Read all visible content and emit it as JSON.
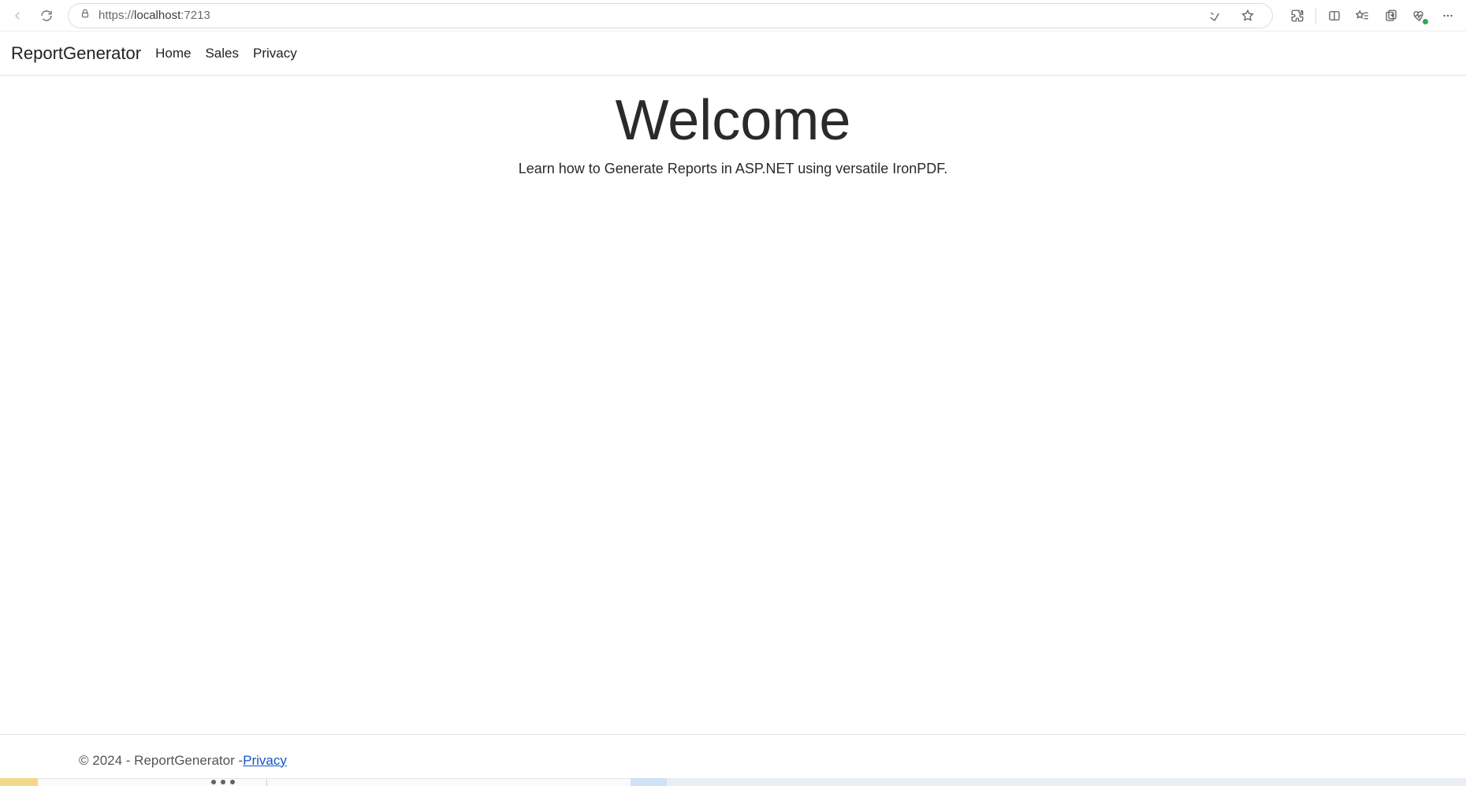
{
  "browser": {
    "url_scheme": "https://",
    "url_host": "localhost",
    "url_port": ":7213"
  },
  "nav": {
    "brand": "ReportGenerator",
    "links": [
      "Home",
      "Sales",
      "Privacy"
    ]
  },
  "main": {
    "title": "Welcome",
    "subtitle": "Learn how to Generate Reports in ASP.NET using versatile IronPDF."
  },
  "footer": {
    "text_prefix": "© 2024 - ReportGenerator - ",
    "privacy_label": "Privacy"
  }
}
